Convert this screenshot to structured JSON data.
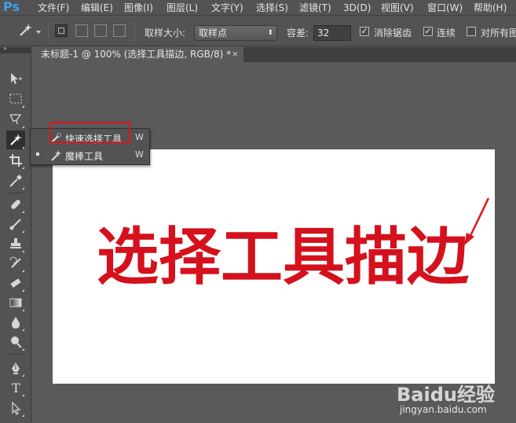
{
  "app": {
    "logo": "Ps"
  },
  "menubar": {
    "items": [
      "文件(F)",
      "编辑(E)",
      "图像(I)",
      "图层(L)",
      "文字(Y)",
      "选择(S)",
      "滤镜(T)",
      "3D(D)",
      "视图(V)",
      "窗口(W)",
      "帮助(H)"
    ]
  },
  "options_bar": {
    "sample_size_label": "取样大小:",
    "sample_size_value": "取样点",
    "tolerance_label": "容差:",
    "tolerance_value": "32",
    "anti_alias_label": "消除锯齿",
    "anti_alias_checked": true,
    "contiguous_label": "连续",
    "contiguous_checked": true,
    "sample_all_layers_label": "对所有图",
    "sample_all_layers_checked": false
  },
  "document_tab": {
    "title": "未标题-1 @ 100% (选择工具描边, RGB/8) *",
    "close_glyph": "×"
  },
  "tool_flyout": {
    "items": [
      {
        "label": "快速选择工具",
        "shortcut": "W",
        "active": false,
        "icon": "quick-selection-icon"
      },
      {
        "label": "魔棒工具",
        "shortcut": "W",
        "active": true,
        "icon": "magic-wand-icon"
      }
    ]
  },
  "canvas": {
    "text": "选择工具描边",
    "text_color": "#d4111c",
    "background": "#ffffff"
  },
  "colors": {
    "accent_red": "#e0141b",
    "ps_blue": "#3e9ff0"
  },
  "watermark": {
    "brand": "Baidu经验",
    "url": "jingyan.baidu.com"
  }
}
